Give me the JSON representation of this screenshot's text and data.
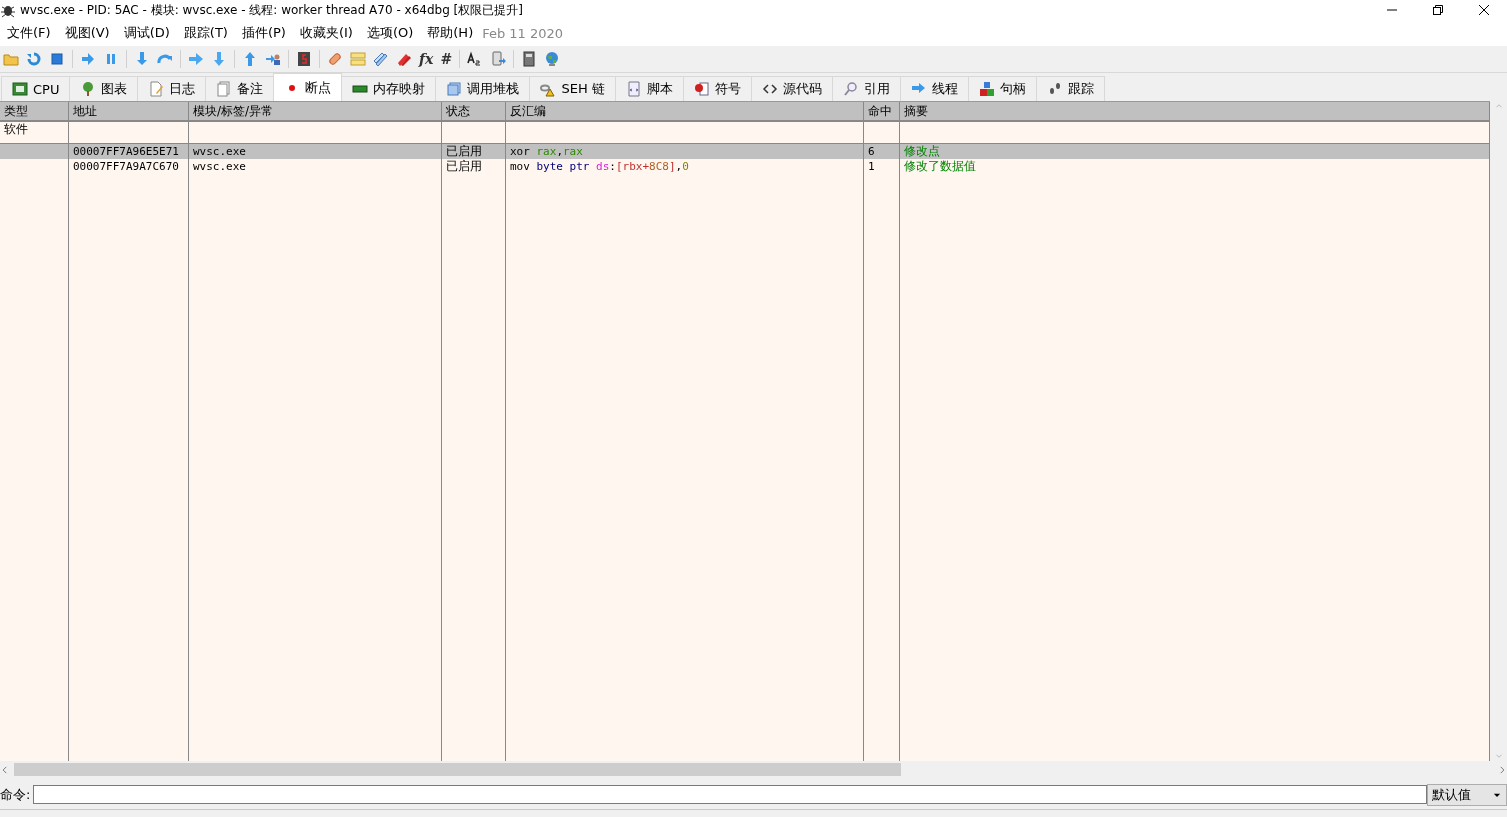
{
  "window": {
    "title": "wvsc.exe - PID: 5AC - 模块: wvsc.exe - 线程: worker thread A70 - x64dbg [权限已提升]"
  },
  "menu": [
    "文件(F)",
    "视图(V)",
    "调试(D)",
    "跟踪(T)",
    "插件(P)",
    "收藏夹(I)",
    "选项(O)",
    "帮助(H)"
  ],
  "build_date": "Feb 11 2020",
  "toolbar_glyphs": [
    "fx",
    "#"
  ],
  "tabs": [
    {
      "label": "CPU",
      "selected": false
    },
    {
      "label": "图表",
      "selected": false
    },
    {
      "label": "日志",
      "selected": false
    },
    {
      "label": "备注",
      "selected": false
    },
    {
      "label": "断点",
      "selected": true
    },
    {
      "label": "内存映射",
      "selected": false
    },
    {
      "label": "调用堆栈",
      "selected": false
    },
    {
      "label": "SEH 链",
      "selected": false
    },
    {
      "label": "脚本",
      "selected": false
    },
    {
      "label": "符号",
      "selected": false
    },
    {
      "label": "源代码",
      "selected": false
    },
    {
      "label": "引用",
      "selected": false
    },
    {
      "label": "线程",
      "selected": false
    },
    {
      "label": "句柄",
      "selected": false
    },
    {
      "label": "跟踪",
      "selected": false
    }
  ],
  "table": {
    "columns": [
      "类型",
      "地址",
      "模块/标签/异常",
      "状态",
      "反汇编",
      "命中",
      "摘要"
    ],
    "group": "软件",
    "rows": [
      {
        "selected": true,
        "address": "00007FF7A96E5E71",
        "module": "wvsc.exe",
        "state": "已启用",
        "hits": "6",
        "summary": "修改点",
        "disasm": [
          {
            "text": "xor ",
            "kind": "mnemonic"
          },
          {
            "text": "rax",
            "kind": "register"
          },
          {
            "text": ",",
            "kind": "punct"
          },
          {
            "text": "rax",
            "kind": "register"
          }
        ]
      },
      {
        "selected": false,
        "address": "00007FF7A9A7C670",
        "module": "wvsc.exe",
        "state": "已启用",
        "hits": "1",
        "summary": "修改了数据值",
        "disasm": [
          {
            "text": "mov ",
            "kind": "mnemonic"
          },
          {
            "text": "byte ptr ",
            "kind": "size"
          },
          {
            "text": "ds",
            "kind": "segment"
          },
          {
            "text": ":",
            "kind": "punct"
          },
          {
            "text": "[",
            "kind": "bracket"
          },
          {
            "text": "rbx",
            "kind": "memreg"
          },
          {
            "text": "+",
            "kind": "bracket"
          },
          {
            "text": "8C8",
            "kind": "offset"
          },
          {
            "text": "]",
            "kind": "bracket"
          },
          {
            "text": ",",
            "kind": "punct"
          },
          {
            "text": "0",
            "kind": "number"
          }
        ]
      }
    ]
  },
  "command": {
    "label": "命令:",
    "dropdown": "默认值"
  }
}
